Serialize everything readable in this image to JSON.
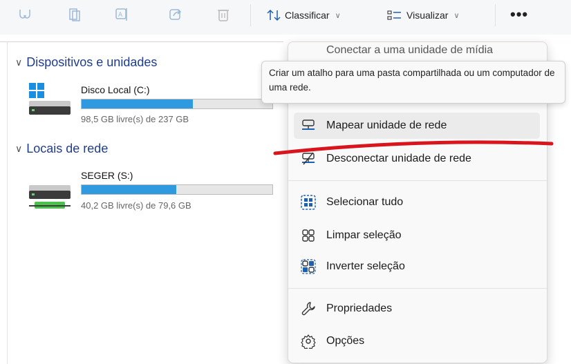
{
  "toolbar": {
    "sort_label": "Classificar",
    "view_label": "Visualizar",
    "more_label": "•••"
  },
  "sections": {
    "devices_title": "Dispositivos e unidades",
    "network_title": "Locais de rede"
  },
  "drives": [
    {
      "name": "Disco Local (C:)",
      "free_text": "98,5 GB livre(s) de 237 GB",
      "used_fraction": 0.585,
      "bar_color": "#2f9ae0"
    },
    {
      "name": "SEGER (S:)",
      "free_text": "40,2 GB livre(s) de 79,6 GB",
      "used_fraction": 0.495,
      "bar_color": "#2f9ae0"
    }
  ],
  "menu": {
    "partial_first_item": "Conectar a uma unidade de mídia",
    "items": [
      {
        "label": "Mapear unidade de rede",
        "icon": "map-network-drive-icon"
      },
      {
        "label": "Desconectar unidade de rede",
        "icon": "disconnect-network-drive-icon"
      },
      {
        "label": "Selecionar tudo",
        "icon": "select-all-icon"
      },
      {
        "label": "Limpar seleção",
        "icon": "clear-selection-icon"
      },
      {
        "label": "Inverter seleção",
        "icon": "invert-selection-icon"
      },
      {
        "label": "Propriedades",
        "icon": "properties-icon"
      },
      {
        "label": "Opções",
        "icon": "options-icon"
      }
    ]
  },
  "tooltip": {
    "text": "Criar um atalho para uma pasta compartilhada ou um computador de uma rede."
  },
  "colors": {
    "accent": "#2f9ae0",
    "section_title": "#1f3d8a",
    "annotation_red": "#d8141c"
  }
}
